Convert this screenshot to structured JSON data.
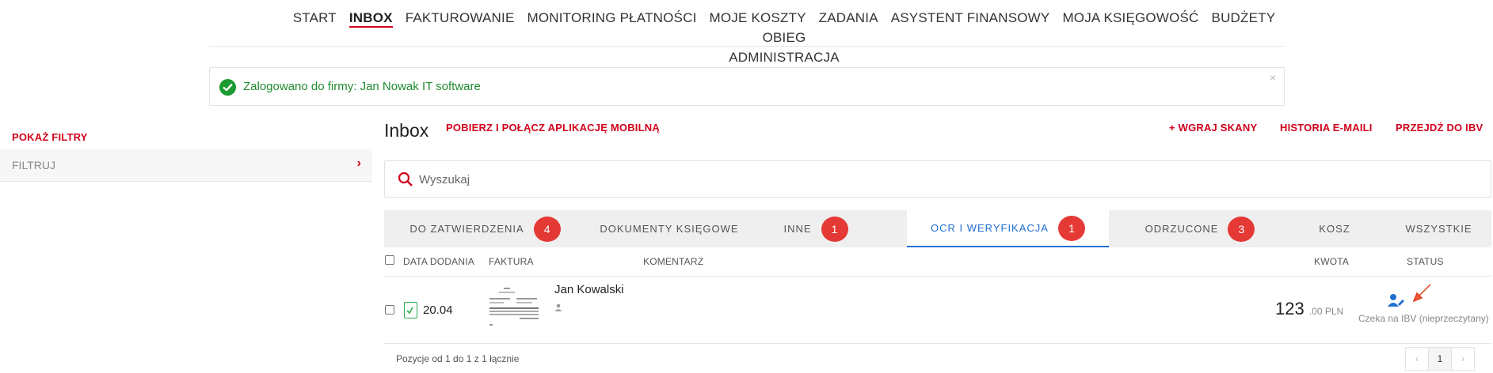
{
  "nav": {
    "items": [
      "START",
      "INBOX",
      "FAKTUROWANIE",
      "MONITORING PŁATNOŚCI",
      "MOJE KOSZTY",
      "ZADANIA",
      "ASYSTENT FINANSOWY",
      "MOJA KSIĘGOWOŚĆ",
      "BUDŻETY",
      "OBIEG"
    ],
    "items_row2": [
      "ADMINISTRACJA"
    ],
    "active": "INBOX"
  },
  "alert": {
    "message": "Zalogowano do firmy: Jan Nowak IT software",
    "close": "×"
  },
  "filters": {
    "show_label": "POKAŻ FILTRY",
    "input_placeholder": "FILTRUJ",
    "chevron": "›"
  },
  "header": {
    "title": "Inbox",
    "mobile_link": "POBIERZ I POŁĄCZ APLIKACJĘ MOBILNĄ",
    "upload_link": "+ WGRAJ SKANY",
    "email_history_link": "HISTORIA E-MAILI",
    "ibv_link": "PRZEJDŹ DO IBV"
  },
  "search": {
    "placeholder": "Wyszukaj"
  },
  "tabs": [
    {
      "label": "DO ZATWIERDZENIA",
      "badge": "4"
    },
    {
      "label": "DOKUMENTY KSIĘGOWE",
      "badge": ""
    },
    {
      "label": "INNE",
      "badge": "1"
    },
    {
      "label": "OCR I WERYFIKACJA",
      "badge": "1"
    },
    {
      "label": "ODRZUCONE",
      "badge": "3"
    },
    {
      "label": "KOSZ",
      "badge": ""
    },
    {
      "label": "WSZYSTKIE",
      "badge": ""
    }
  ],
  "active_tab": "OCR I WERYFIKACJA",
  "table": {
    "columns": {
      "date": "DATA DODANIA",
      "invoice": "FAKTURA",
      "comment": "KOMENTARZ",
      "amount": "KWOTA",
      "status": "STATUS"
    },
    "rows": [
      {
        "date": "20.04",
        "name": "Jan Kowalski",
        "amount_int": "123",
        "amount_frac": ".00 PLN",
        "status": "Czeka na IBV (nieprzeczytany)"
      }
    ]
  },
  "footer": {
    "summary": "Pozycje od 1 do 1 z 1 łącznie",
    "prev": "‹",
    "page": "1",
    "next": "›"
  },
  "colors": {
    "accent": "#d0021b",
    "active_tab": "#1f6fd1",
    "badge": "#e53935",
    "success": "#1a9a2f"
  }
}
